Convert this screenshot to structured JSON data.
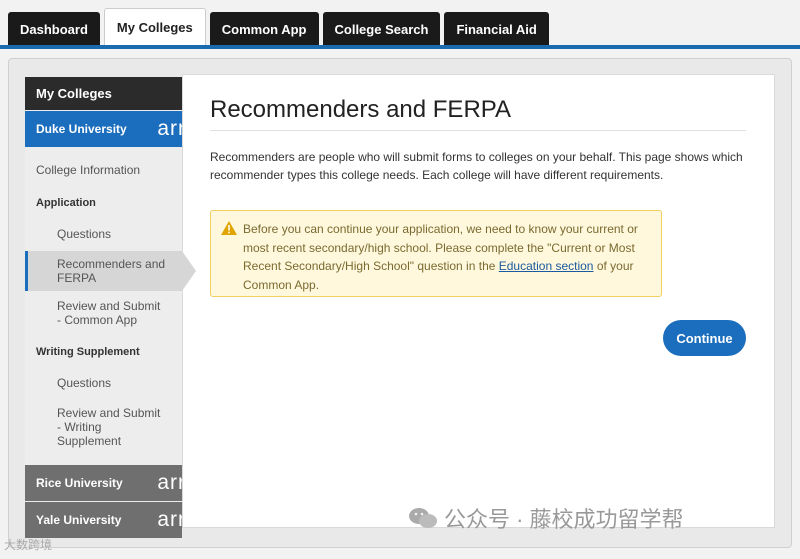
{
  "tabs": [
    "Dashboard",
    "My Colleges",
    "Common App",
    "College Search",
    "Financial Aid"
  ],
  "sidebar": {
    "heading": "My Colleges",
    "colleges": {
      "duke": "Duke University",
      "rice": "Rice University",
      "yale": "Yale University",
      "arrow_text": "arr"
    },
    "college_information": "College Information",
    "application_section": "Application",
    "questions": "Questions",
    "recommenders": "Recommenders and FERPA",
    "review_common": "Review and Submit - Common App",
    "writing_section": "Writing Supplement",
    "questions2": "Questions",
    "review_writing": "Review and Submit - Writing Supplement"
  },
  "main": {
    "title": "Recommenders and FERPA",
    "description": "Recommenders are people who will submit forms to colleges on your behalf. This page shows which recommender types this college needs. Each college will have different requirements.",
    "alert_before": "Before you can continue your application, we need to know your current or most recent secondary/high school. Please complete the \"Current or Most Recent Secondary/High School\" question in the ",
    "alert_link": "Education section",
    "alert_after": " of your Common App.",
    "continue_label": "Continue"
  },
  "watermark": {
    "main": "公众号 · 藤校成功留学帮",
    "corner": "大数跨境"
  },
  "colors": {
    "accent_blue": "#1b6dbd",
    "tab_dark": "#1a1a1a",
    "alert_bg": "#fff8dc",
    "alert_border": "#f0d060"
  },
  "icons": {
    "warning": "warning-triangle-icon",
    "wechat": "wechat-icon"
  }
}
